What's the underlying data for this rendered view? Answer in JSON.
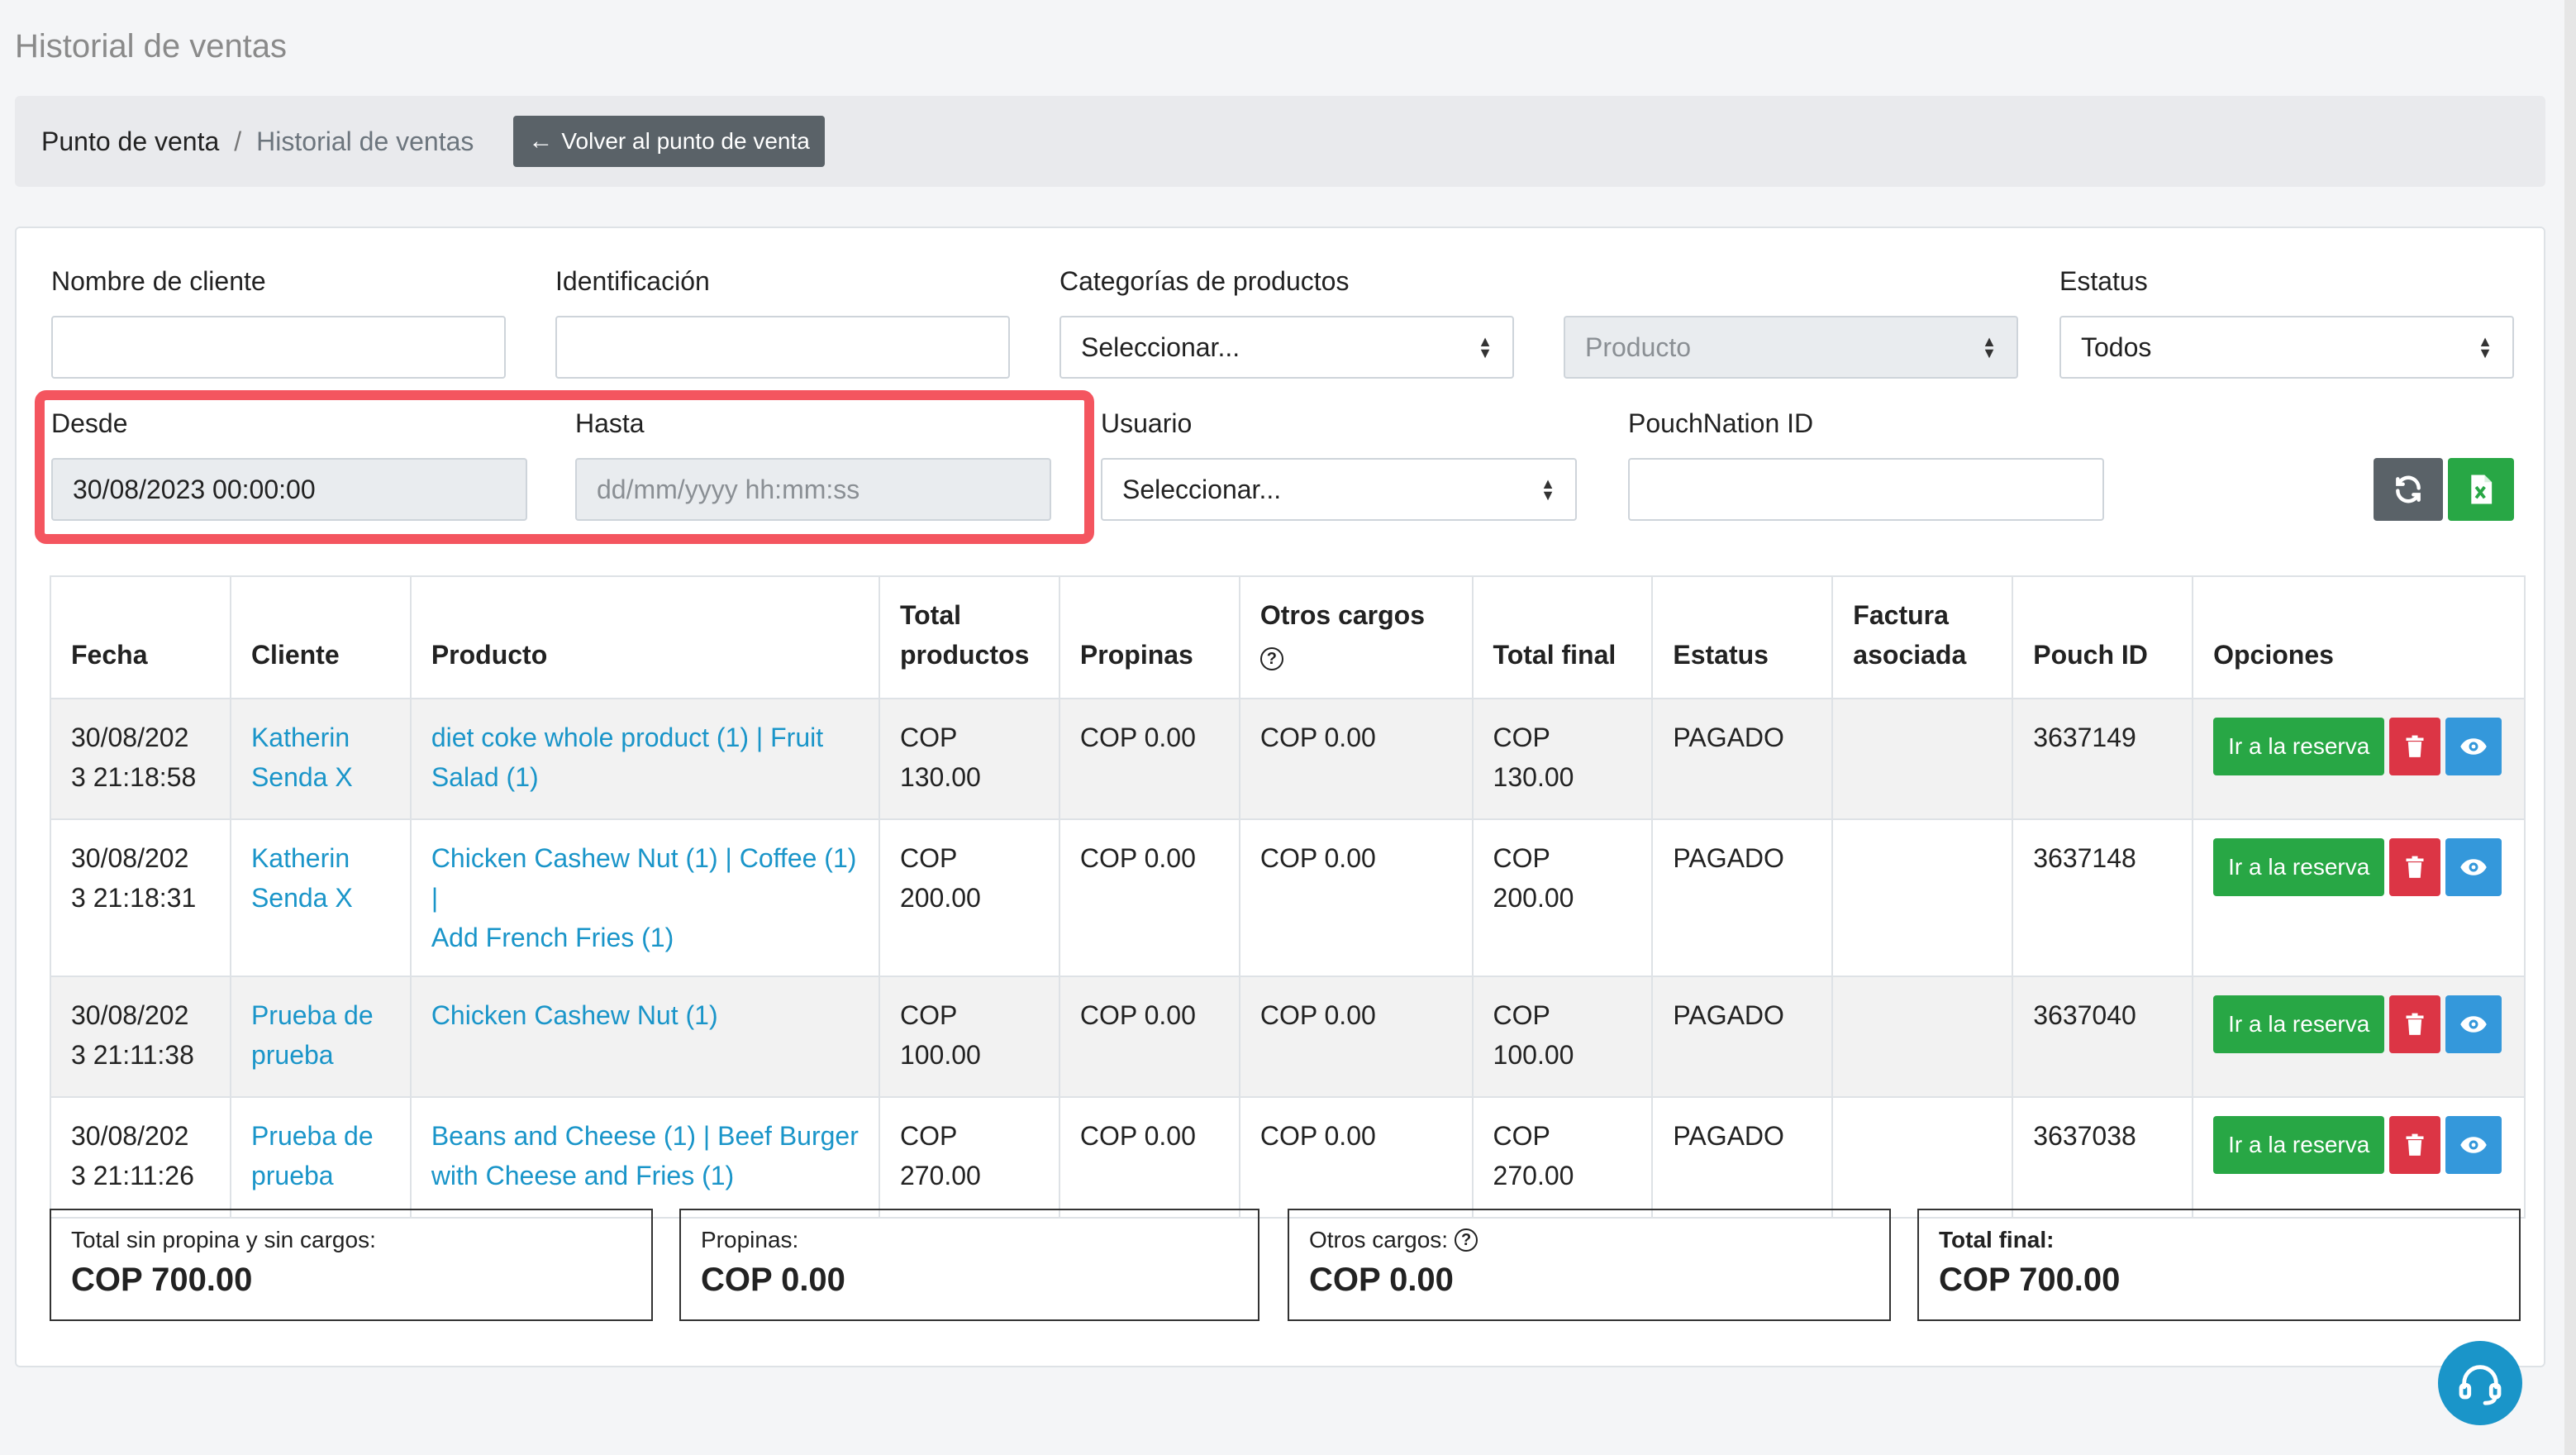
{
  "page": {
    "title": "Historial de ventas"
  },
  "breadcrumb": {
    "root": "Punto de venta",
    "separator": "/",
    "current": "Historial de ventas"
  },
  "back_button": {
    "label": "Volver al punto de venta",
    "icon": "arrow-left-icon"
  },
  "filters": {
    "nombre_cliente": {
      "label": "Nombre de cliente",
      "value": ""
    },
    "identificacion": {
      "label": "Identificación",
      "value": ""
    },
    "categorias": {
      "label": "Categorías de productos",
      "value": "Seleccionar..."
    },
    "producto": {
      "value": "Producto"
    },
    "estatus": {
      "label": "Estatus",
      "value": "Todos"
    },
    "desde": {
      "label": "Desde",
      "value": "30/08/2023 00:00:00"
    },
    "hasta": {
      "label": "Hasta",
      "placeholder": "dd/mm/yyyy hh:mm:ss"
    },
    "usuario": {
      "label": "Usuario",
      "value": "Seleccionar..."
    },
    "pouchnation_id": {
      "label": "PouchNation ID",
      "value": ""
    }
  },
  "table": {
    "headers": {
      "fecha": "Fecha",
      "cliente": "Cliente",
      "producto": "Producto",
      "total_productos_1": "Total",
      "total_productos_2": "productos",
      "propinas": "Propinas",
      "otros_cargos": "Otros cargos",
      "total_final": "Total final",
      "estatus": "Estatus",
      "factura_1": "Factura",
      "factura_2": "asociada",
      "pouch_id": "Pouch ID",
      "opciones": "Opciones"
    },
    "rows": [
      {
        "fecha_1": "30/08/202",
        "fecha_2": "3 21:18:58",
        "cliente_1": "Katherin",
        "cliente_2": "Senda X",
        "producto_1": "diet coke whole product (1) | Fruit",
        "producto_2": "Salad (1)",
        "total_1": "COP",
        "total_2": "130.00",
        "propinas": "COP 0.00",
        "otros": "COP 0.00",
        "final_1": "COP",
        "final_2": "130.00",
        "estatus": "PAGADO",
        "pouch": "3637149",
        "reserva": "Ir a la reserva"
      },
      {
        "fecha_1": "30/08/202",
        "fecha_2": "3 21:18:31",
        "cliente_1": "Katherin",
        "cliente_2": "Senda X",
        "producto_1": "Chicken Cashew Nut (1) | Coffee (1) |",
        "producto_2": "Add French Fries (1)",
        "total_1": "COP",
        "total_2": "200.00",
        "propinas": "COP 0.00",
        "otros": "COP 0.00",
        "final_1": "COP",
        "final_2": "200.00",
        "estatus": "PAGADO",
        "pouch": "3637148",
        "reserva": "Ir a la reserva"
      },
      {
        "fecha_1": "30/08/202",
        "fecha_2": "3 21:11:38",
        "cliente_1": "Prueba de",
        "cliente_2": "prueba",
        "producto_1": "Chicken Cashew Nut (1)",
        "producto_2": "",
        "total_1": "COP",
        "total_2": "100.00",
        "propinas": "COP 0.00",
        "otros": "COP 0.00",
        "final_1": "COP",
        "final_2": "100.00",
        "estatus": "PAGADO",
        "pouch": "3637040",
        "reserva": "Ir a la reserva"
      },
      {
        "fecha_1": "30/08/202",
        "fecha_2": "3 21:11:26",
        "cliente_1": "Prueba de",
        "cliente_2": "prueba",
        "producto_1": "Beans and Cheese (1) | Beef Burger",
        "producto_2": "with Cheese and Fries (1)",
        "total_1": "COP",
        "total_2": "270.00",
        "propinas": "COP 0.00",
        "otros": "COP 0.00",
        "final_1": "COP",
        "final_2": "270.00",
        "estatus": "PAGADO",
        "pouch": "3637038",
        "reserva": "Ir a la reserva"
      }
    ]
  },
  "summary": {
    "sin_propina": {
      "label": "Total sin propina y sin cargos:",
      "value": "COP 700.00"
    },
    "propinas": {
      "label": "Propinas:",
      "value": "COP 0.00"
    },
    "otros_cargos": {
      "label": "Otros cargos:",
      "value": "COP 0.00"
    },
    "total_final": {
      "label": "Total final:",
      "value": "COP 700.00"
    }
  },
  "colors": {
    "highlight": "#f4555f",
    "link": "#1a95c9",
    "success": "#28a745",
    "danger": "#dc3545",
    "info": "#3498db"
  }
}
